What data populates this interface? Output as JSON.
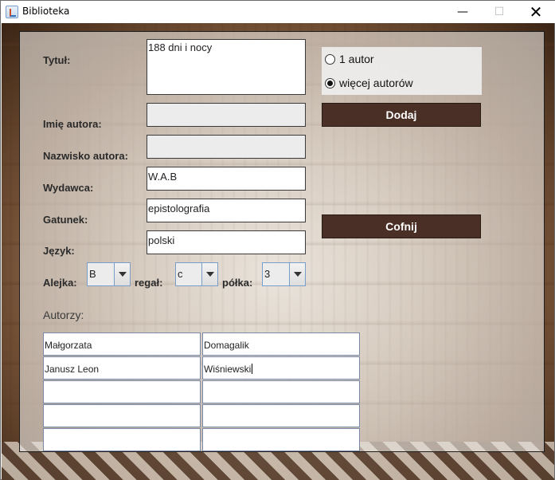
{
  "window": {
    "title": "Biblioteka"
  },
  "form": {
    "tytul": {
      "label": "Tytuł:",
      "value": "188 dni i nocy"
    },
    "imie": {
      "label": "Imię autora:",
      "value": ""
    },
    "nazwisko": {
      "label": "Nazwisko autora:",
      "value": ""
    },
    "wydawca": {
      "label": "Wydawca:",
      "value": "W.A.B"
    },
    "gatunek": {
      "label": "Gatunek:",
      "value": "epistolografia"
    },
    "jezyk": {
      "label": "Język:",
      "value": "polski"
    },
    "alejka": {
      "label": "Alejka:",
      "value": "B"
    },
    "regal": {
      "label": "regał:",
      "value": "c"
    },
    "polka": {
      "label": "półka:",
      "value": "3"
    }
  },
  "authors_mode": {
    "options": [
      {
        "label": "1 autor",
        "checked": false
      },
      {
        "label": "więcej autorów",
        "checked": true
      }
    ]
  },
  "buttons": {
    "add": "Dodaj",
    "back": "Cofnij"
  },
  "authors": {
    "label": "Autorzy:",
    "rows": [
      {
        "first": "Małgorzata",
        "last": "Domagalik"
      },
      {
        "first": "Janusz Leon",
        "last": "Wiśniewski"
      },
      {
        "first": "",
        "last": ""
      },
      {
        "first": "",
        "last": ""
      },
      {
        "first": "",
        "last": ""
      }
    ]
  },
  "colors": {
    "button_bg": "#4a2f26",
    "panel_overlay": "#ece8e4",
    "accent_border": "#7a9cc8"
  }
}
